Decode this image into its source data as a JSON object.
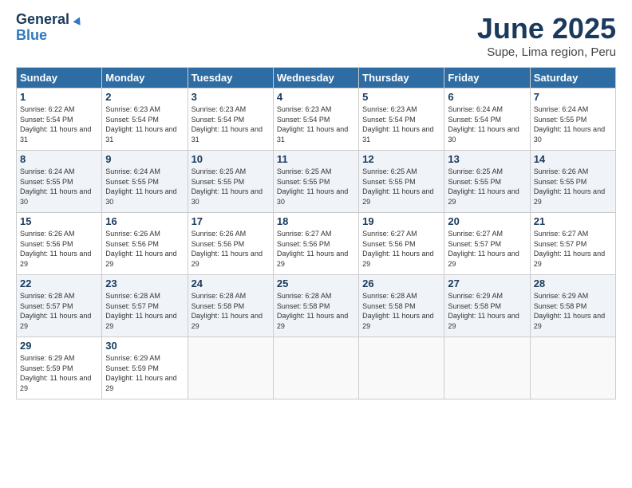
{
  "header": {
    "logo_line1": "General",
    "logo_line2": "Blue",
    "title": "June 2025",
    "subtitle": "Supe, Lima region, Peru"
  },
  "days_of_week": [
    "Sunday",
    "Monday",
    "Tuesday",
    "Wednesday",
    "Thursday",
    "Friday",
    "Saturday"
  ],
  "weeks": [
    [
      {
        "day": "1",
        "sunrise": "6:22 AM",
        "sunset": "5:54 PM",
        "daylight": "11 hours and 31 minutes."
      },
      {
        "day": "2",
        "sunrise": "6:23 AM",
        "sunset": "5:54 PM",
        "daylight": "11 hours and 31 minutes."
      },
      {
        "day": "3",
        "sunrise": "6:23 AM",
        "sunset": "5:54 PM",
        "daylight": "11 hours and 31 minutes."
      },
      {
        "day": "4",
        "sunrise": "6:23 AM",
        "sunset": "5:54 PM",
        "daylight": "11 hours and 31 minutes."
      },
      {
        "day": "5",
        "sunrise": "6:23 AM",
        "sunset": "5:54 PM",
        "daylight": "11 hours and 31 minutes."
      },
      {
        "day": "6",
        "sunrise": "6:24 AM",
        "sunset": "5:54 PM",
        "daylight": "11 hours and 30 minutes."
      },
      {
        "day": "7",
        "sunrise": "6:24 AM",
        "sunset": "5:55 PM",
        "daylight": "11 hours and 30 minutes."
      }
    ],
    [
      {
        "day": "8",
        "sunrise": "6:24 AM",
        "sunset": "5:55 PM",
        "daylight": "11 hours and 30 minutes."
      },
      {
        "day": "9",
        "sunrise": "6:24 AM",
        "sunset": "5:55 PM",
        "daylight": "11 hours and 30 minutes."
      },
      {
        "day": "10",
        "sunrise": "6:25 AM",
        "sunset": "5:55 PM",
        "daylight": "11 hours and 30 minutes."
      },
      {
        "day": "11",
        "sunrise": "6:25 AM",
        "sunset": "5:55 PM",
        "daylight": "11 hours and 30 minutes."
      },
      {
        "day": "12",
        "sunrise": "6:25 AM",
        "sunset": "5:55 PM",
        "daylight": "11 hours and 29 minutes."
      },
      {
        "day": "13",
        "sunrise": "6:25 AM",
        "sunset": "5:55 PM",
        "daylight": "11 hours and 29 minutes."
      },
      {
        "day": "14",
        "sunrise": "6:26 AM",
        "sunset": "5:55 PM",
        "daylight": "11 hours and 29 minutes."
      }
    ],
    [
      {
        "day": "15",
        "sunrise": "6:26 AM",
        "sunset": "5:56 PM",
        "daylight": "11 hours and 29 minutes."
      },
      {
        "day": "16",
        "sunrise": "6:26 AM",
        "sunset": "5:56 PM",
        "daylight": "11 hours and 29 minutes."
      },
      {
        "day": "17",
        "sunrise": "6:26 AM",
        "sunset": "5:56 PM",
        "daylight": "11 hours and 29 minutes."
      },
      {
        "day": "18",
        "sunrise": "6:27 AM",
        "sunset": "5:56 PM",
        "daylight": "11 hours and 29 minutes."
      },
      {
        "day": "19",
        "sunrise": "6:27 AM",
        "sunset": "5:56 PM",
        "daylight": "11 hours and 29 minutes."
      },
      {
        "day": "20",
        "sunrise": "6:27 AM",
        "sunset": "5:57 PM",
        "daylight": "11 hours and 29 minutes."
      },
      {
        "day": "21",
        "sunrise": "6:27 AM",
        "sunset": "5:57 PM",
        "daylight": "11 hours and 29 minutes."
      }
    ],
    [
      {
        "day": "22",
        "sunrise": "6:28 AM",
        "sunset": "5:57 PM",
        "daylight": "11 hours and 29 minutes."
      },
      {
        "day": "23",
        "sunrise": "6:28 AM",
        "sunset": "5:57 PM",
        "daylight": "11 hours and 29 minutes."
      },
      {
        "day": "24",
        "sunrise": "6:28 AM",
        "sunset": "5:58 PM",
        "daylight": "11 hours and 29 minutes."
      },
      {
        "day": "25",
        "sunrise": "6:28 AM",
        "sunset": "5:58 PM",
        "daylight": "11 hours and 29 minutes."
      },
      {
        "day": "26",
        "sunrise": "6:28 AM",
        "sunset": "5:58 PM",
        "daylight": "11 hours and 29 minutes."
      },
      {
        "day": "27",
        "sunrise": "6:29 AM",
        "sunset": "5:58 PM",
        "daylight": "11 hours and 29 minutes."
      },
      {
        "day": "28",
        "sunrise": "6:29 AM",
        "sunset": "5:58 PM",
        "daylight": "11 hours and 29 minutes."
      }
    ],
    [
      {
        "day": "29",
        "sunrise": "6:29 AM",
        "sunset": "5:59 PM",
        "daylight": "11 hours and 29 minutes."
      },
      {
        "day": "30",
        "sunrise": "6:29 AM",
        "sunset": "5:59 PM",
        "daylight": "11 hours and 29 minutes."
      },
      null,
      null,
      null,
      null,
      null
    ]
  ]
}
